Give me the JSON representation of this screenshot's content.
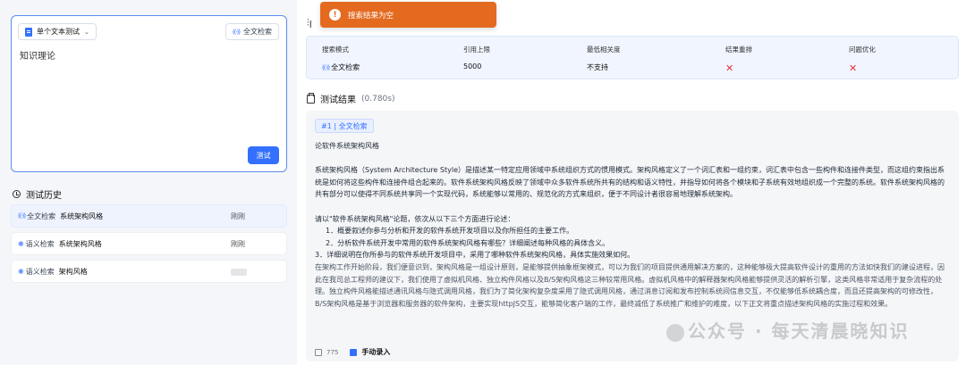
{
  "toast": {
    "message": "搜索结果为空"
  },
  "input_panel": {
    "mode_label": "单个文本测试",
    "search_mode_tag": "全文检索",
    "query_text": "知识理论",
    "test_button": "测试"
  },
  "history": {
    "title": "测试历史",
    "items": [
      {
        "mode": "全文检索",
        "text": "系统架构风格",
        "time": "刚刚"
      },
      {
        "mode": "语义检索",
        "text": "系统架构风格",
        "time": "刚刚"
      },
      {
        "mode": "语义检索",
        "text": "架构风格",
        "time": ""
      }
    ]
  },
  "config_table": {
    "headers": [
      "搜索模式",
      "引用上限",
      "最低相关度",
      "结果重排",
      "问题优化"
    ],
    "values": [
      "全文检索",
      "5000",
      "不支持",
      "✕",
      "✕"
    ]
  },
  "results": {
    "title": "测试结果",
    "duration": "(0.780s)",
    "rank_badge": "#1 | 全文检索",
    "doc_title": "论软件系统架构风格",
    "para1": "系统架构风格（System Architecture Style）是描述某一特定应用领域中系统组织方式的惯用模式。架构风格定义了一个词汇表和一组约束，词汇表中包含一些构件和连接件类型，而这组约束指出系统是如何将这些构件和连接件组合起来的。软件系统架构风格反映了领域中众多软件系统所共有的结构和语义特性，并指导如何将各个模块和子系统有效地组织成一个完整的系统。软件系统架构风格的共有部分可以使得不同系统共享同一个实现代码，系统能够以常用的、规范化的方式来组织，便于不同设计者很容易地理解系统架构。",
    "question_intro": "请以\"软件系统架构风格\"论题，依次从以下三个方面进行论述：",
    "q1": "1．概要叙述你参与分析和开发的软件系统开发项目以及你所担任的主要工作。",
    "q2": "2．分析软件系统开发中常用的软件系统架构风格有哪些？详细阐述每种风格的具体含义。",
    "q3": "3．详细说明在你所参与的软件系统开发项目中，采用了哪种软件系统架构风格，具体实施效果如何。",
    "para2": "在架构工作开始阶段，我们便意识到，架构风格是一组设计原则，是能够提供抽象框架模式，可以为我们的项目提供通用解决方案的，这种能够极大提高软件设计的重用的方法如快我们的建设进程，因此在我司总工程师的建议下，我们使用了虚拟机风格、独立构件风格以及B/S架构风格这三种较常用风格。虚拟机风格中的解释器架构风格能够提供灵活的解析引擎，这类风格非常适用于复杂流程的处理。独立构件风格能描述通讯风格与隐式调用风格，我们为了简化架构复杂度采用了隐式调用风格，通过消息订阅和发布控制系统间信息交互，不仅能够低系统耦合度，而且还提高架构的可修改性，B/S架构风格是基于浏览器和服务器的软件架构，主要实现httpJS交互，能够简化客户端的工作，最终减低了系统推广和维护的难度，以下正文将重点描述架构风格的实施过程和效果。",
    "char_count": "775",
    "source": "手动录入"
  },
  "watermark": "公众号 · 每天清晨晓知识"
}
